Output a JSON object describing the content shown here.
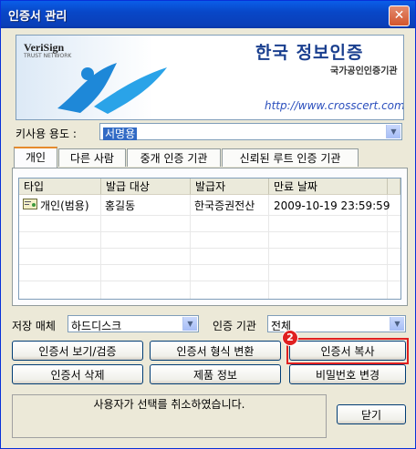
{
  "window": {
    "title": "인증서 관리",
    "close_label": "✕"
  },
  "banner": {
    "verisign": "VeriSign",
    "trust_network": "TRUST NETWORK",
    "logo_text": "한국 정보인증",
    "logo_sub": "국가공인인증기관",
    "url": "http://www.crosscert.com"
  },
  "usage": {
    "label": "키사용 용도 :",
    "value": "서명용"
  },
  "tabs": [
    "개인",
    "다른 사람",
    "중개 인증 기관",
    "신뢰된 루트 인증 기관"
  ],
  "table": {
    "headers": [
      "타입",
      "발급 대상",
      "발급자",
      "만료 날짜"
    ],
    "rows": [
      {
        "type": "개인(범용)",
        "subject": "홍길동",
        "issuer": "한국증권전산",
        "expiry": "2009-10-19 23:59:59"
      }
    ]
  },
  "storage": {
    "label": "저장 매체",
    "value": "하드디스크"
  },
  "ca": {
    "label": "인증 기관",
    "value": "전체"
  },
  "buttons": {
    "view": "인증서 보기/검증",
    "convert": "인증서 형식 변환",
    "copy": "인증서 복사",
    "delete": "인증서 삭제",
    "product_info": "제품 정보",
    "change_password": "비밀번호 변경",
    "close": "닫기"
  },
  "annotation": {
    "step": "2",
    "color": "#e02020"
  },
  "status_message": "사용자가 선택를 취소하였습니다.",
  "colors": {
    "title_bar": "#0a5ee8",
    "selection": "#316ac5",
    "tab_accent": "#e68b2c"
  }
}
